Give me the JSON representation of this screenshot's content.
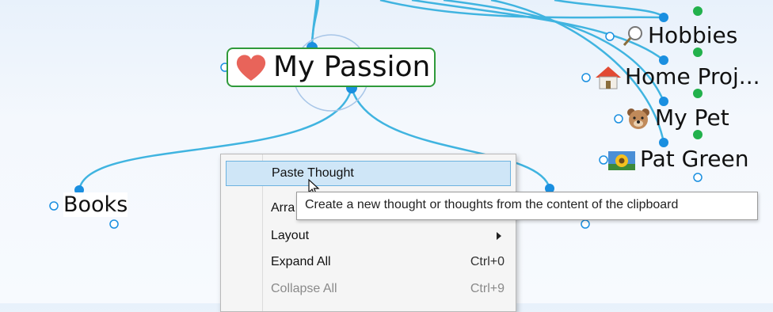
{
  "map": {
    "central_thought": "My Passion",
    "left_thoughts": [
      {
        "label": "Books"
      }
    ],
    "right_thoughts": [
      {
        "label": "Hobbies",
        "icon": "magnifier-icon"
      },
      {
        "label": "Home Proj...",
        "icon": "house-icon"
      },
      {
        "label": "My Pet",
        "icon": "dog-icon"
      },
      {
        "label": "Pat Green",
        "icon": "sunflower-photo-icon"
      }
    ],
    "colors": {
      "link": "#40b4e0",
      "node_blue": "#1a8fe0",
      "node_green": "#22b14c",
      "active_border": "#2f9a3a",
      "heart": "#e8645a"
    }
  },
  "context_menu": {
    "items": [
      {
        "label": "Paste Thought",
        "shortcut": "",
        "state": "highlighted"
      },
      {
        "label": "Arra",
        "shortcut": "",
        "state": "normal"
      },
      {
        "label": "Layout",
        "shortcut": "",
        "state": "submenu"
      },
      {
        "label": "Expand All",
        "shortcut": "Ctrl+0",
        "state": "normal"
      },
      {
        "label": "Collapse All",
        "shortcut": "Ctrl+9",
        "state": "disabled"
      }
    ]
  },
  "tooltip": {
    "text": "Create a new thought or thoughts from the content of the clipboard"
  }
}
